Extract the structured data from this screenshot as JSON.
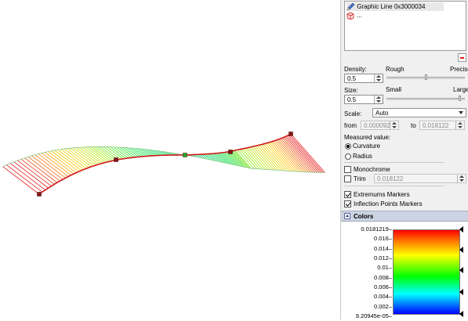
{
  "tree": {
    "item1": "Graphic Line 0x3000034",
    "item2": "..."
  },
  "density": {
    "label": "Density:",
    "value": "0.5",
    "low_label": "Rough",
    "high_label": "Precise",
    "level": 0.5
  },
  "size": {
    "label": "Size:",
    "value": "0.5",
    "low_label": "Small",
    "high_label": "Large",
    "level": 0.95
  },
  "scale": {
    "label": "Scale:",
    "value": "Auto"
  },
  "range": {
    "from_label": "from",
    "from_value": "0.000092",
    "to_label": "to",
    "to_value": "0.018122"
  },
  "measured": {
    "label": "Measured value:",
    "options": [
      "Curvature",
      "Radius"
    ],
    "selected": "Curvature"
  },
  "monochrome": {
    "label": "Monochrome",
    "checked": false
  },
  "trim": {
    "label": "Trim",
    "checked": false,
    "value": "0.018122"
  },
  "extremums": {
    "label": "Extremums Markers",
    "checked": true
  },
  "inflection": {
    "label": "Inflection Points Markers",
    "checked": true
  },
  "colors_section": {
    "title": "Colors",
    "ticks": [
      "0.0181219",
      "0.016",
      "0.014",
      "0.012",
      "0.01",
      "0.008",
      "0.006",
      "0.004",
      "0.002",
      "9.20945e-05"
    ],
    "gradient": [
      "#ff0000",
      "#ff8000",
      "#ffff00",
      "#00ff00",
      "#00ffff",
      "#0000ff"
    ]
  },
  "colors": {
    "curve": "#d01818",
    "extremum_marker": "#8a1414",
    "inflection_marker": "#22aa22",
    "section_header": "#ccd3e2"
  }
}
